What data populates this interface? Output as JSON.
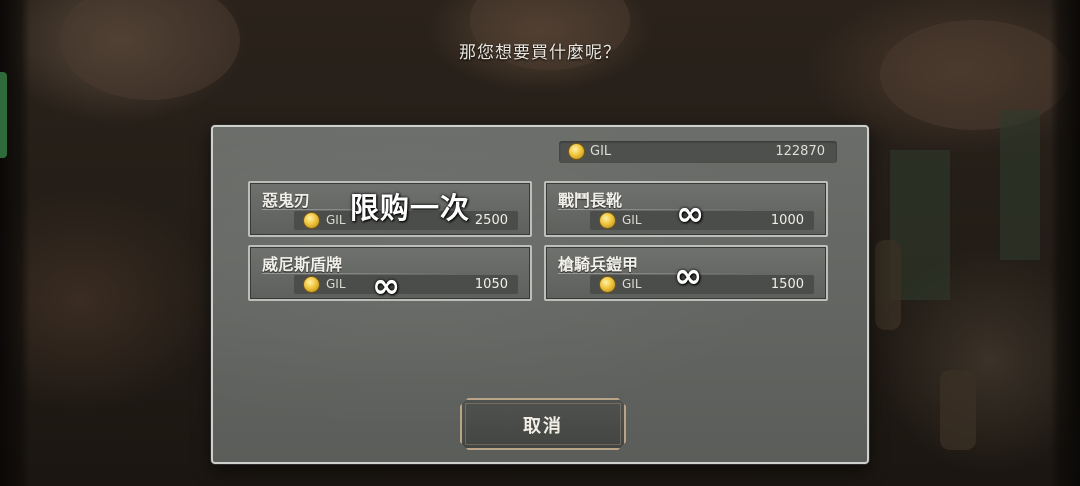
{
  "prompt": "那您想要買什麼呢？",
  "currency": {
    "label": "GIL",
    "icon": "gil-coin-icon",
    "balance": "122870"
  },
  "items": [
    {
      "name": "惡鬼刃",
      "currency": "GIL",
      "price": "2500",
      "overlay": "限购一次"
    },
    {
      "name": "戰鬥長靴",
      "currency": "GIL",
      "price": "1000",
      "overlay": "∞"
    },
    {
      "name": "威尼斯盾牌",
      "currency": "GIL",
      "price": "1050",
      "overlay": "∞"
    },
    {
      "name": "槍騎兵鎧甲",
      "currency": "GIL",
      "price": "1500",
      "overlay": "∞"
    }
  ],
  "cancel_label": "取消",
  "colors": {
    "panel": "#646663",
    "frame": "#cfcfcc",
    "coin": "#f0c53c",
    "cancel_border": "#b9a488"
  }
}
